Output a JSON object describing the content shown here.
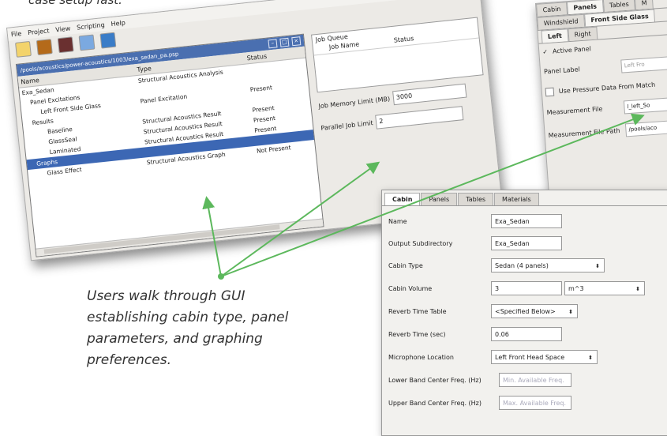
{
  "top_caption": "case setup fast.",
  "caption": "Users walk through GUI establishing cabin type, panel parameters, and graphing preferences.",
  "main_window": {
    "menu": [
      "File",
      "Project",
      "View",
      "Scripting",
      "Help"
    ],
    "project_path": "/pools/acoustics/power-acoustics/1003/exa_sedan_pa.psp",
    "columns": [
      "Name",
      "Type",
      "Status"
    ],
    "tree": [
      {
        "name": "Exa_Sedan",
        "type": "Structural Acoustics Analysis",
        "status": ""
      },
      {
        "name": "Panel Excitations",
        "type": "",
        "status": ""
      },
      {
        "name": "Left Front Side Glass",
        "type": "Panel Excitation",
        "status": "Present"
      },
      {
        "name": "Results",
        "type": "",
        "status": ""
      },
      {
        "name": "Baseline",
        "type": "Structural Acoustics Result",
        "status": "Present"
      },
      {
        "name": "GlassSeal",
        "type": "Structural Acoustics Result",
        "status": "Present"
      },
      {
        "name": "Laminated",
        "type": "Structural Acoustics Result",
        "status": "Present"
      },
      {
        "name": "Graphs",
        "type": "",
        "status": ""
      },
      {
        "name": "Glass Effect",
        "type": "Structural Acoustics Graph",
        "status": "Not Present"
      }
    ],
    "job_queue": {
      "title": "Job Queue",
      "columns": [
        "Job Name",
        "Status"
      ]
    },
    "job_memory_label": "Job Memory Limit (MB)",
    "job_memory_value": "3000",
    "parallel_label": "Parallel Job Limit",
    "parallel_value": "2"
  },
  "panels_window": {
    "tabs": [
      "Cabin",
      "Panels",
      "Tables",
      "M"
    ],
    "subtabs": [
      "Windshield",
      "Front Side Glass"
    ],
    "side_tabs": [
      "Left",
      "Right"
    ],
    "active_panel_label": "Active Panel",
    "panel_label_label": "Panel Label",
    "panel_label_value": "Left Fro",
    "use_pressure_label": "Use Pressure Data From Match",
    "measurement_file_label": "Measurement File",
    "measurement_file_value": "l_left_So",
    "measurement_path_label": "Measurement File Path",
    "measurement_path_value": "/pools/aco"
  },
  "cabin_window": {
    "tabs": [
      "Cabin",
      "Panels",
      "Tables",
      "Materials"
    ],
    "fields": [
      {
        "label": "Name",
        "value": "Exa_Sedan"
      },
      {
        "label": "Output Subdirectory",
        "value": "Exa_Sedan"
      },
      {
        "label": "Cabin Type",
        "value": "Sedan (4 panels)"
      },
      {
        "label": "Cabin Volume",
        "value": "3",
        "unit": "m^3"
      },
      {
        "label": "Reverb Time Table",
        "value": "<Specified Below>"
      },
      {
        "label": "Reverb Time (sec)",
        "value": "0.06"
      },
      {
        "label": "Microphone Location",
        "value": "Left Front Head Space"
      },
      {
        "label": "Lower Band Center Freq. (Hz)",
        "placeholder": "Min. Available Freq."
      },
      {
        "label": "Upper Band Center Freq. (Hz)",
        "placeholder": "Max. Available Freq."
      }
    ]
  },
  "colors": {
    "accent": "#3c67b4",
    "arrow": "#5cb85c"
  }
}
